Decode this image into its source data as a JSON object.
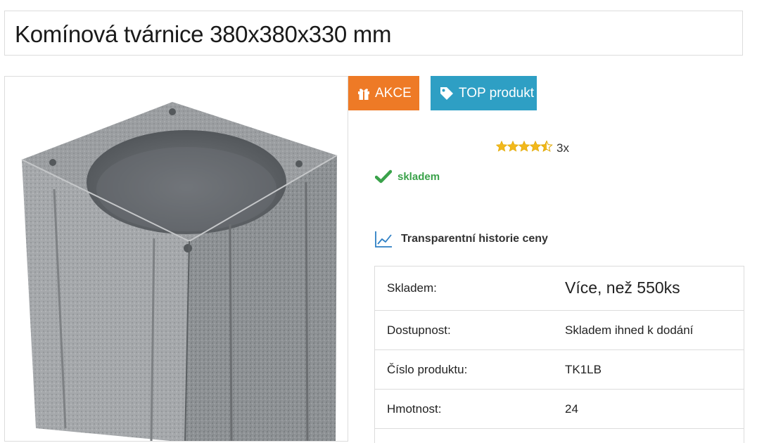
{
  "product": {
    "title": "Komínová tvárnice 380x380x330 mm",
    "image_alt": "Komínová tvárnice"
  },
  "badges": {
    "akce_label": "AKCE",
    "top_label": "TOP produkt",
    "akce_color": "#ee7a26",
    "top_color": "#2e9fc4"
  },
  "rating": {
    "stars": 4.5,
    "max": 5,
    "count_label": "3x"
  },
  "availability": {
    "status": "skladem",
    "icon": "checkmark-icon",
    "color": "#3aa24a"
  },
  "price_history": {
    "link_label": "Transparentní historie ceny",
    "icon": "line-chart-icon"
  },
  "params": [
    {
      "label": "Skladem:",
      "value": "Více, než 550ks"
    },
    {
      "label": "Dostupnost:",
      "value": "Skladem ihned k dodání"
    },
    {
      "label": "Číslo produktu:",
      "value": "TK1LB"
    },
    {
      "label": "Hmotnost:",
      "value": "24"
    }
  ]
}
